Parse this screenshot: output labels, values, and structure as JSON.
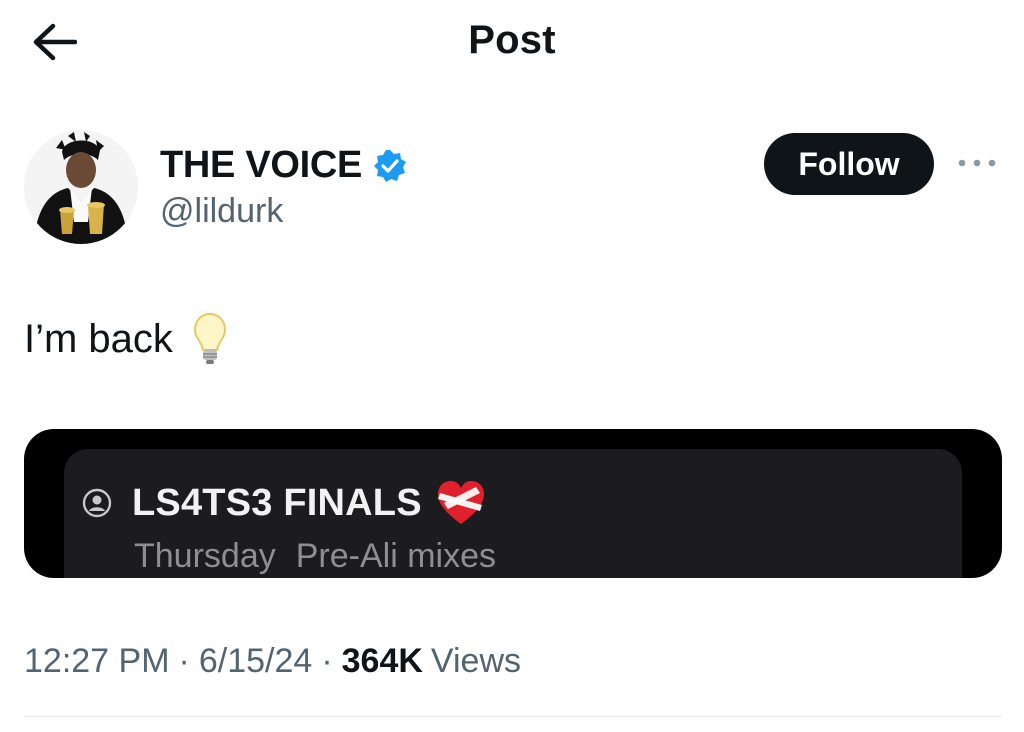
{
  "header": {
    "title": "Post",
    "back_icon": "arrow-left-icon"
  },
  "author": {
    "display_name": "THE VOICE",
    "handle": "@lildurk",
    "verified": true,
    "verified_color": "#1d9bf0",
    "follow_label": "Follow",
    "more_icon": "ellipsis-icon"
  },
  "post": {
    "text": "I’m back",
    "emoji": "lightbulb-icon"
  },
  "media": {
    "playlist_title": "LS4TS3 FINALS",
    "title_icon": "person-circle-icon",
    "title_emoji": "bandaged-heart-icon",
    "subtitle_day": "Thursday",
    "subtitle_text": "Pre-Ali mixes"
  },
  "meta": {
    "time": "12:27 PM",
    "separator": "·",
    "date": "6/15/24",
    "views_count": "364K",
    "views_label": "Views"
  },
  "colors": {
    "text": "#0f1419",
    "secondary": "#536471",
    "follow_bg": "#0f1419",
    "media_bg": "#000000",
    "media_card": "#1c1c1e"
  }
}
